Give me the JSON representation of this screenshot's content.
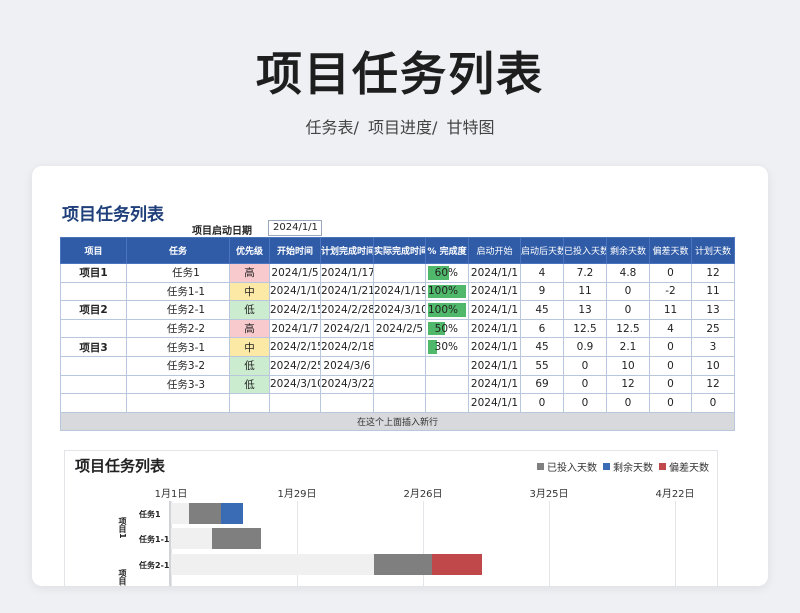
{
  "hero": {
    "title": "项目任务列表",
    "subtitle_parts": [
      "任务表/",
      "项目进度/",
      "甘特图"
    ]
  },
  "sheet": {
    "title": "项目任务列表",
    "start_label": "项目启动日期",
    "start_value": "2024/1/1",
    "headers": [
      "项目",
      "任务",
      "优先级",
      "开始时间",
      "计划完成时间",
      "实际完成时间",
      "% 完成度",
      "启动开始",
      "启动后天数",
      "已投入天数",
      "剩余天数",
      "偏差天数",
      "计划天数"
    ],
    "rows": [
      {
        "project": "项目1",
        "task": "任务1",
        "priority": "高",
        "start": "2024/1/5",
        "plan_end": "2024/1/17",
        "actual_end": "",
        "pct": "60%",
        "pct_value": 60,
        "launch": "2024/1/1",
        "days_after": "4",
        "invested": "7.2",
        "remaining": "4.8",
        "deviation": "0",
        "plan_days": "12"
      },
      {
        "project": "",
        "task": "任务1-1",
        "priority": "中",
        "start": "2024/1/10",
        "plan_end": "2024/1/21",
        "actual_end": "2024/1/19",
        "pct": "100%",
        "pct_value": 100,
        "launch": "2024/1/1",
        "days_after": "9",
        "invested": "11",
        "remaining": "0",
        "deviation": "-2",
        "plan_days": "11"
      },
      {
        "project": "项目2",
        "task": "任务2-1",
        "priority": "低",
        "start": "2024/2/15",
        "plan_end": "2024/2/28",
        "actual_end": "2024/3/10",
        "pct": "100%",
        "pct_value": 100,
        "launch": "2024/1/1",
        "days_after": "45",
        "invested": "13",
        "remaining": "0",
        "deviation": "11",
        "plan_days": "13"
      },
      {
        "project": "",
        "task": "任务2-2",
        "priority": "高",
        "start": "2024/1/7",
        "plan_end": "2024/2/1",
        "actual_end": "2024/2/5",
        "pct": "50%",
        "pct_value": 50,
        "launch": "2024/1/1",
        "days_after": "6",
        "invested": "12.5",
        "remaining": "12.5",
        "deviation": "4",
        "plan_days": "25"
      },
      {
        "project": "项目3",
        "task": "任务3-1",
        "priority": "中",
        "start": "2024/2/15",
        "plan_end": "2024/2/18",
        "actual_end": "",
        "pct": "30%",
        "pct_value": 30,
        "launch": "2024/1/1",
        "days_after": "45",
        "invested": "0.9",
        "remaining": "2.1",
        "deviation": "0",
        "plan_days": "3"
      },
      {
        "project": "",
        "task": "任务3-2",
        "priority": "低",
        "start": "2024/2/25",
        "plan_end": "2024/3/6",
        "actual_end": "",
        "pct": "",
        "pct_value": 0,
        "launch": "2024/1/1",
        "days_after": "55",
        "invested": "0",
        "remaining": "10",
        "deviation": "0",
        "plan_days": "10"
      },
      {
        "project": "",
        "task": "任务3-3",
        "priority": "低",
        "start": "2024/3/10",
        "plan_end": "2024/3/22",
        "actual_end": "",
        "pct": "",
        "pct_value": 0,
        "launch": "2024/1/1",
        "days_after": "69",
        "invested": "0",
        "remaining": "12",
        "deviation": "0",
        "plan_days": "12"
      },
      {
        "project": "",
        "task": "",
        "priority": "",
        "start": "",
        "plan_end": "",
        "actual_end": "",
        "pct": "",
        "pct_value": 0,
        "launch": "2024/1/1",
        "days_after": "0",
        "invested": "0",
        "remaining": "0",
        "deviation": "0",
        "plan_days": "0"
      }
    ],
    "insert_row_label": "在这个上面插入新行"
  },
  "colors": {
    "header_blue": "#2f5ba7",
    "title_blue": "#1f3f7a",
    "priority_high": "#f8c9cd",
    "priority_mid": "#fde9a6",
    "priority_low": "#cbeccf",
    "progress_green": "#4fb86a",
    "invested_gray": "#7f7f7f",
    "remaining_blue": "#3a6bb5",
    "deviation_red": "#c0474a",
    "offset_light": "#f0f0f0"
  },
  "chart_data": {
    "type": "bar",
    "title": "项目任务列表",
    "orientation": "horizontal-stacked",
    "x_ticks": [
      "1月1日",
      "1月29日",
      "2月26日",
      "3月25日",
      "4月22日"
    ],
    "xlim": [
      0,
      126
    ],
    "legend": [
      "已投入天数",
      "剩余天数",
      "偏差天数"
    ],
    "legend_position": "top-right",
    "groups": [
      {
        "label": "项目1",
        "tasks": [
          "任务1",
          "任务1-1"
        ]
      },
      {
        "label": "项目2",
        "tasks": [
          "任务2-1"
        ]
      }
    ],
    "categories": [
      "任务1",
      "任务1-1",
      "任务2-1"
    ],
    "offset": [
      4,
      9,
      45
    ],
    "series": [
      {
        "name": "已投入天数",
        "values": [
          7.2,
          11,
          13
        ]
      },
      {
        "name": "剩余天数",
        "values": [
          4.8,
          0,
          0
        ]
      },
      {
        "name": "偏差天数",
        "values": [
          0,
          0,
          11
        ]
      }
    ]
  }
}
